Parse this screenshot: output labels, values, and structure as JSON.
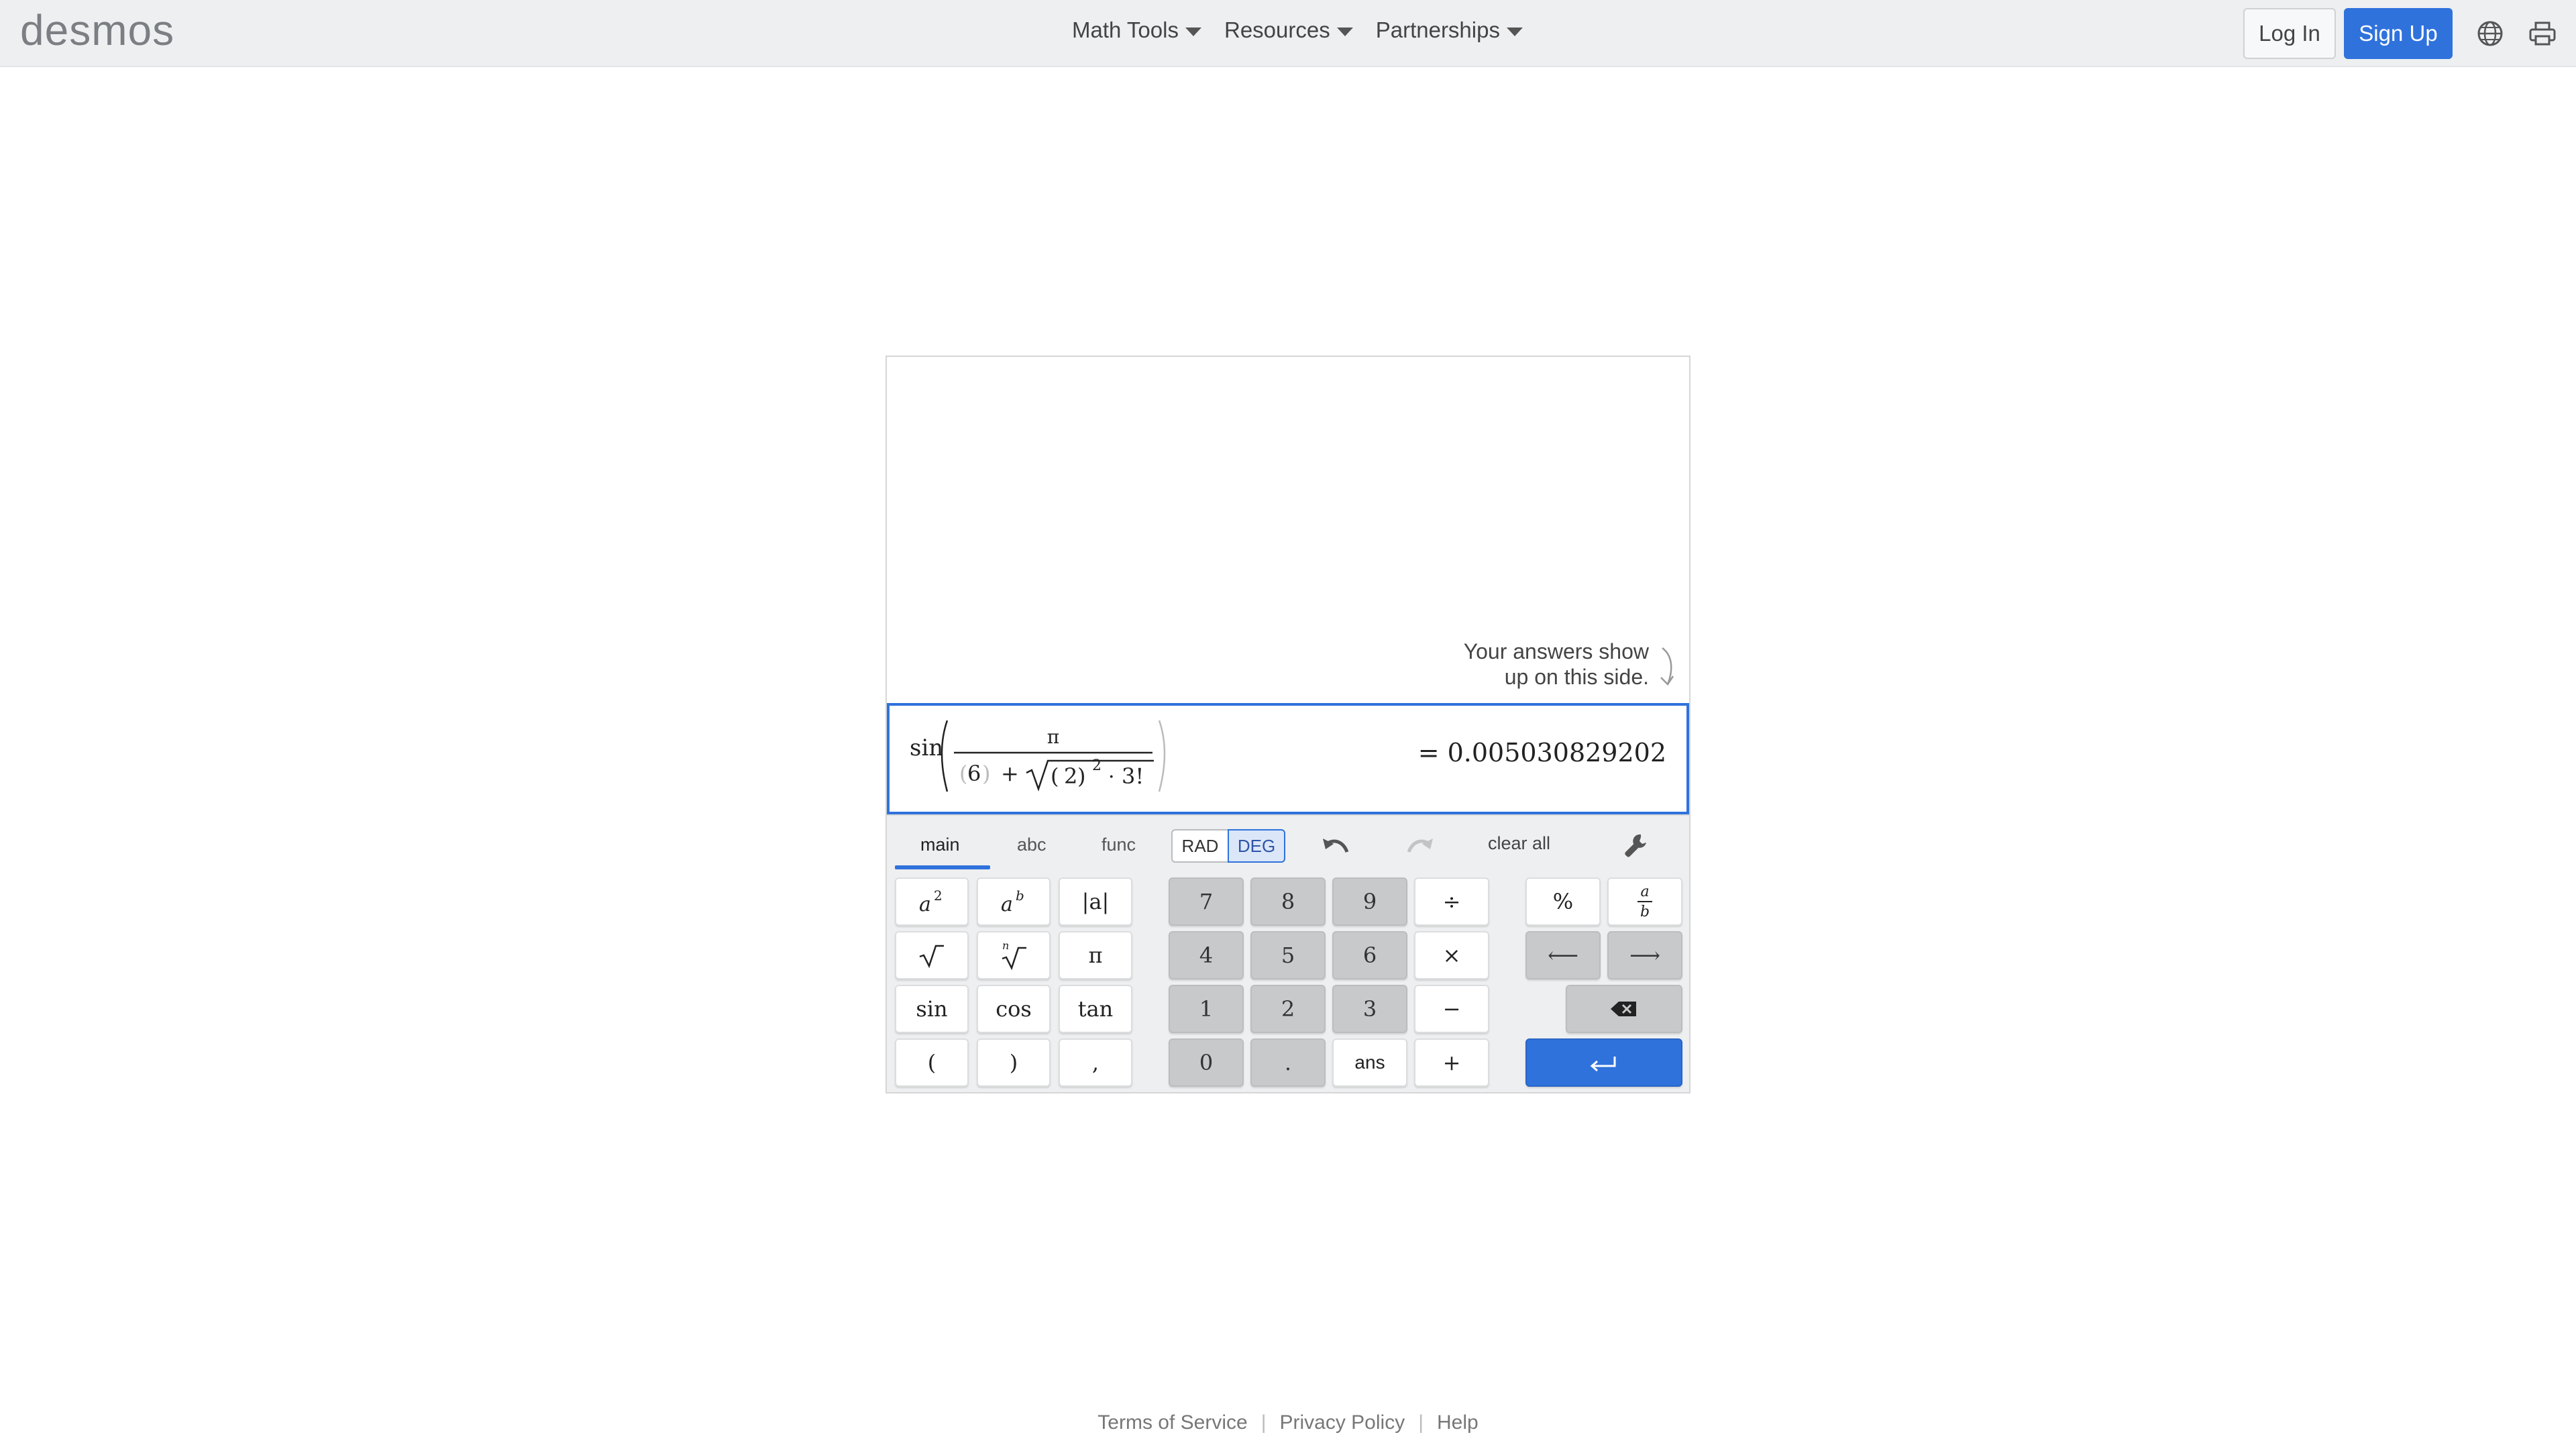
{
  "header": {
    "logo": "desmos",
    "nav": [
      "Math Tools",
      "Resources",
      "Partnerships"
    ],
    "login_label": "Log In",
    "signup_label": "Sign Up",
    "icons": [
      "globe-icon",
      "print-icon"
    ]
  },
  "calculator": {
    "hint_line1": "Your answers show",
    "hint_line2": "up on this side.",
    "expression": {
      "func": "sin",
      "numerator": "π",
      "den_paren_value": "6",
      "plus": "+",
      "sqrt_base": "2",
      "sqrt_exponent": "2",
      "dot": "·",
      "factorial": "3!"
    },
    "answer": "= 0.005030829202",
    "tabs": [
      "main",
      "abc",
      "func"
    ],
    "active_tab": "main",
    "modes": [
      "RAD",
      "DEG"
    ],
    "active_mode": "DEG",
    "clear_all": "clear all",
    "keys": {
      "sin": "sin",
      "cos": "cos",
      "tan": "tan",
      "pi": "π",
      "abs": "|a|",
      "lparen": "(",
      "rparen": ")",
      "comma": ",",
      "n7": "7",
      "n8": "8",
      "n9": "9",
      "div": "÷",
      "n4": "4",
      "n5": "5",
      "n6": "6",
      "mul": "×",
      "n1": "1",
      "n2": "2",
      "n3": "3",
      "minus": "−",
      "n0": "0",
      "dot": ".",
      "ans": "ans",
      "plus": "+",
      "percent": "%",
      "left": "⟵",
      "right": "⟶"
    }
  },
  "footer": {
    "links": [
      "Terms of Service",
      "Privacy Policy",
      "Help"
    ]
  },
  "colors": {
    "accent": "#2f72dc",
    "header_bg": "#edeff1",
    "keypad_bg": "#eeeff0"
  }
}
